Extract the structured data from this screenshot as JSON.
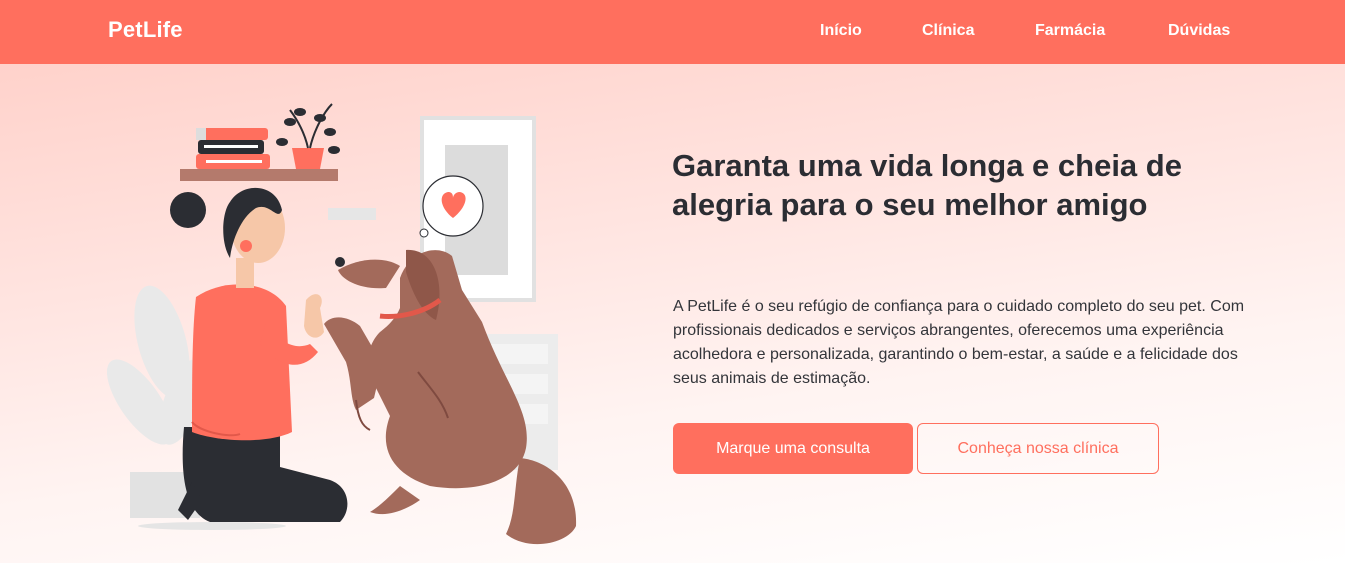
{
  "header": {
    "logo": "PetLife",
    "nav": [
      {
        "label": "Início"
      },
      {
        "label": "Clínica"
      },
      {
        "label": "Farmácia"
      },
      {
        "label": "Dúvidas"
      }
    ]
  },
  "hero": {
    "title": "Garanta uma vida longa e cheia de alegria para o seu melhor amigo",
    "description": "A PetLife é o seu refúgio de confiança para o cuidado completo do seu pet. Com profissionais dedicados e serviços abrangentes, oferecemos uma experiência acolhedora e personalizada, garantindo o bem-estar, a saúde e a felicidade dos seus animais de estimação.",
    "primary_cta": "Marque uma consulta",
    "secondary_cta": "Conheça nossa clínica",
    "illustration_icon": "woman-high-five-dog-illustration"
  },
  "colors": {
    "brand": "#ff6f5e",
    "text": "#2b2d33",
    "dog": "#a36a5b"
  }
}
